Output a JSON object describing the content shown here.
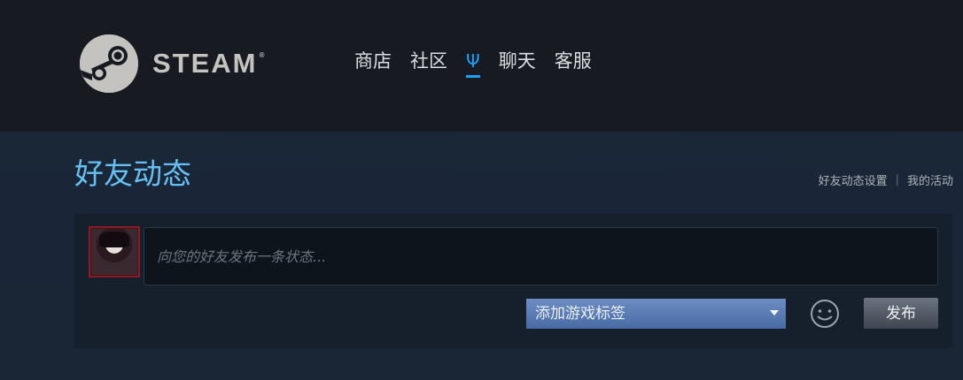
{
  "header": {
    "logo_text": "STEAM",
    "logo_reg": "®",
    "nav": [
      {
        "label": "商店",
        "active": false
      },
      {
        "label": "社区",
        "active": false
      },
      {
        "label": "Ψ",
        "active": true
      },
      {
        "label": "聊天",
        "active": false
      },
      {
        "label": "客服",
        "active": false
      }
    ]
  },
  "page": {
    "title": "好友动态",
    "links": {
      "settings": "好友动态设置",
      "separator": "|",
      "my_activity": "我的活动"
    }
  },
  "composer": {
    "placeholder": "向您的好友发布一条状态...",
    "game_tag_label": "添加游戏标签",
    "post_label": "发布",
    "emoji_icon": "smiley-icon"
  },
  "colors": {
    "header_bg": "#171a21",
    "page_bg": "#1b2838",
    "title": "#66c0f4",
    "accent": "#1a9fff",
    "dropdown": "#587ab4"
  }
}
